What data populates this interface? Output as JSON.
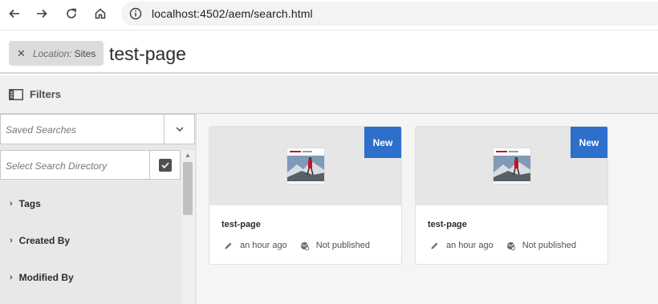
{
  "browser": {
    "url": "localhost:4502/aem/search.html"
  },
  "search": {
    "location_key": "Location:",
    "location_value": "Sites",
    "query": "test-page"
  },
  "filters": {
    "label": "Filters",
    "saved_searches_placeholder": "Saved Searches",
    "directory_placeholder": "Select Search Directory",
    "facets": [
      "Tags",
      "Created By",
      "Modified By"
    ]
  },
  "cards": [
    {
      "title": "test-page",
      "badge": "New",
      "modified": "an hour ago",
      "status": "Not published"
    },
    {
      "title": "test-page",
      "badge": "New",
      "modified": "an hour ago",
      "status": "Not published"
    }
  ],
  "colors": {
    "badge": "#2d6fcb",
    "filters_bar": "#f0f0f0",
    "rail": "#e8e8e8"
  }
}
